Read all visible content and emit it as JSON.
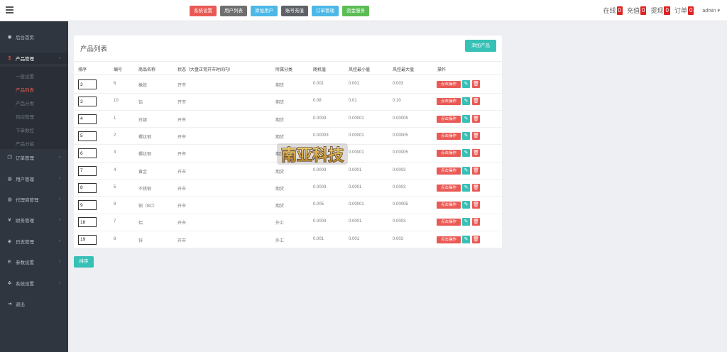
{
  "colors": {
    "danger": "#e95a55",
    "teal": "#36c0b6",
    "sidebar_bg": "#30363f",
    "badge": "#e02222"
  },
  "topnav": [
    {
      "label": "系统设置",
      "color": "#e95a55"
    },
    {
      "label": "用户列表",
      "color": "#6f6f6f"
    },
    {
      "label": "添加用户",
      "color": "#4db8e6"
    },
    {
      "label": "账号充值",
      "color": "#5e6267"
    },
    {
      "label": "订单管理",
      "color": "#4db8e6"
    },
    {
      "label": "资金服务",
      "color": "#5bbd54"
    }
  ],
  "topright": {
    "stats": [
      {
        "label": "在线",
        "count": "0"
      },
      {
        "label": "充值",
        "count": "0"
      },
      {
        "label": "提现",
        "count": "0"
      },
      {
        "label": "订单",
        "count": "0"
      }
    ],
    "admin": "admin",
    "admin_caret": "▾"
  },
  "sidebar": {
    "items": [
      {
        "label": "后台首页",
        "icon": "dashboard-icon",
        "glyph": "◉"
      },
      {
        "label": "产品管理",
        "icon": "product-icon",
        "glyph": "$"
      },
      {
        "label": "订单管理",
        "icon": "order-icon",
        "glyph": "❐"
      },
      {
        "label": "用户管理",
        "icon": "user-icon",
        "glyph": "◍"
      },
      {
        "label": "代理商管理",
        "icon": "agent-icon",
        "glyph": "◍"
      },
      {
        "label": "财务管理",
        "icon": "finance-icon",
        "glyph": "¥"
      },
      {
        "label": "日志管理",
        "icon": "log-icon",
        "glyph": "◈"
      },
      {
        "label": "参数设置",
        "icon": "param-icon",
        "glyph": "E"
      },
      {
        "label": "系统设置",
        "icon": "settings-icon",
        "glyph": "✲"
      },
      {
        "label": "退出",
        "icon": "logout-icon",
        "glyph": "⇥"
      }
    ],
    "submenu": [
      "一般设置",
      "产品列表",
      "产品分类",
      "风控管理",
      "下单数控",
      "产品分组"
    ],
    "arrow": "›"
  },
  "panel": {
    "title": "产品列表",
    "add_button": "添加产品",
    "headers": [
      "排序",
      "编号",
      "商品名称",
      "状态（大盘正常开市时间内）",
      "所属分类",
      "随机值",
      "风控最小值",
      "风控最大值",
      "操作"
    ],
    "rows": [
      {
        "sort": "3",
        "id": "6",
        "name": "橡胶",
        "status": "开市",
        "category": "期货",
        "random": "0.001",
        "min": "0.001",
        "max": "0.003"
      },
      {
        "sort": "3",
        "id": "10",
        "name": "铝",
        "status": "开市",
        "category": "期货",
        "random": "0.08",
        "min": "0.01",
        "max": "0.10"
      },
      {
        "sort": "4",
        "id": "1",
        "name": "白银",
        "status": "开市",
        "category": "期货",
        "random": "0.0003",
        "min": "0.00001",
        "max": "0.00005"
      },
      {
        "sort": "5",
        "id": "2",
        "name": "螺纹钢",
        "status": "开市",
        "category": "期货",
        "random": "0.00003",
        "min": "0.00001",
        "max": "0.00005"
      },
      {
        "sort": "6",
        "id": "3",
        "name": "螺纹钢",
        "status": "开市",
        "category": "期货",
        "random": "0.0003",
        "min": "0.00001",
        "max": "0.00005"
      },
      {
        "sort": "7",
        "id": "4",
        "name": "黄金",
        "status": "开市",
        "category": "期货",
        "random": "0.0003",
        "min": "0.0001",
        "max": "0.0003"
      },
      {
        "sort": "8",
        "id": "5",
        "name": "不锈钢",
        "status": "开市",
        "category": "期货",
        "random": "0.0003",
        "min": "0.0001",
        "max": "0.0003"
      },
      {
        "sort": "9",
        "id": "9",
        "name": "铜（BC）",
        "status": "开市",
        "category": "期货",
        "random": "0.005",
        "min": "0.00001",
        "max": "0.00005"
      },
      {
        "sort": "18",
        "id": "7",
        "name": "铝",
        "status": "开市",
        "category": "外汇",
        "random": "0.0003",
        "min": "0.0001",
        "max": "0.0003"
      },
      {
        "sort": "19",
        "id": "8",
        "name": "锌",
        "status": "开市",
        "category": "外汇",
        "random": "0.001",
        "min": "0.001",
        "max": "0.003"
      }
    ],
    "action_label": "点击操作",
    "edit_glyph": "✎",
    "delete_glyph": "🗑"
  },
  "sort_button": "排序",
  "watermark": "南亚科技"
}
